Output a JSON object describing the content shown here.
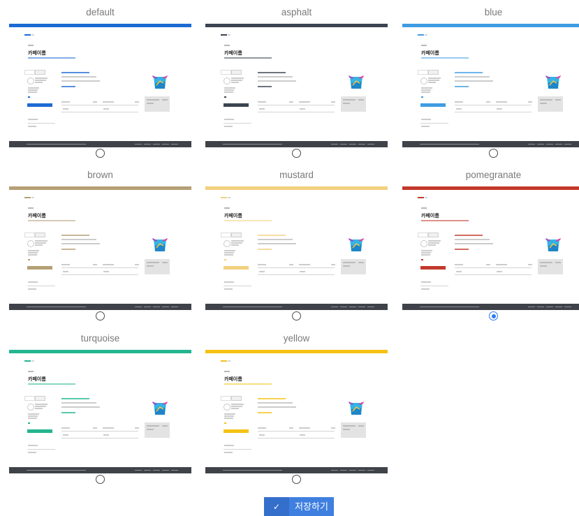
{
  "themes": [
    {
      "key": "default",
      "name": "default",
      "color": "#1c6ad4",
      "selected": false
    },
    {
      "key": "asphalt",
      "name": "asphalt",
      "color": "#3b4450",
      "selected": false
    },
    {
      "key": "blue",
      "name": "blue",
      "color": "#3f9ce3",
      "selected": false
    },
    {
      "key": "brown",
      "name": "brown",
      "color": "#b59f74",
      "selected": false
    },
    {
      "key": "mustard",
      "name": "mustard",
      "color": "#f2d17e",
      "selected": false
    },
    {
      "key": "pomegranate",
      "name": "pomegranate",
      "color": "#c3392b",
      "selected": true
    },
    {
      "key": "turquoise",
      "name": "turquoise",
      "color": "#23b58f",
      "selected": false
    },
    {
      "key": "yellow",
      "name": "yellow",
      "color": "#f4c214",
      "selected": false
    }
  ],
  "preview": {
    "page_title": "카페이름"
  },
  "save_button": {
    "icon": "check-icon",
    "label": "저장하기"
  }
}
